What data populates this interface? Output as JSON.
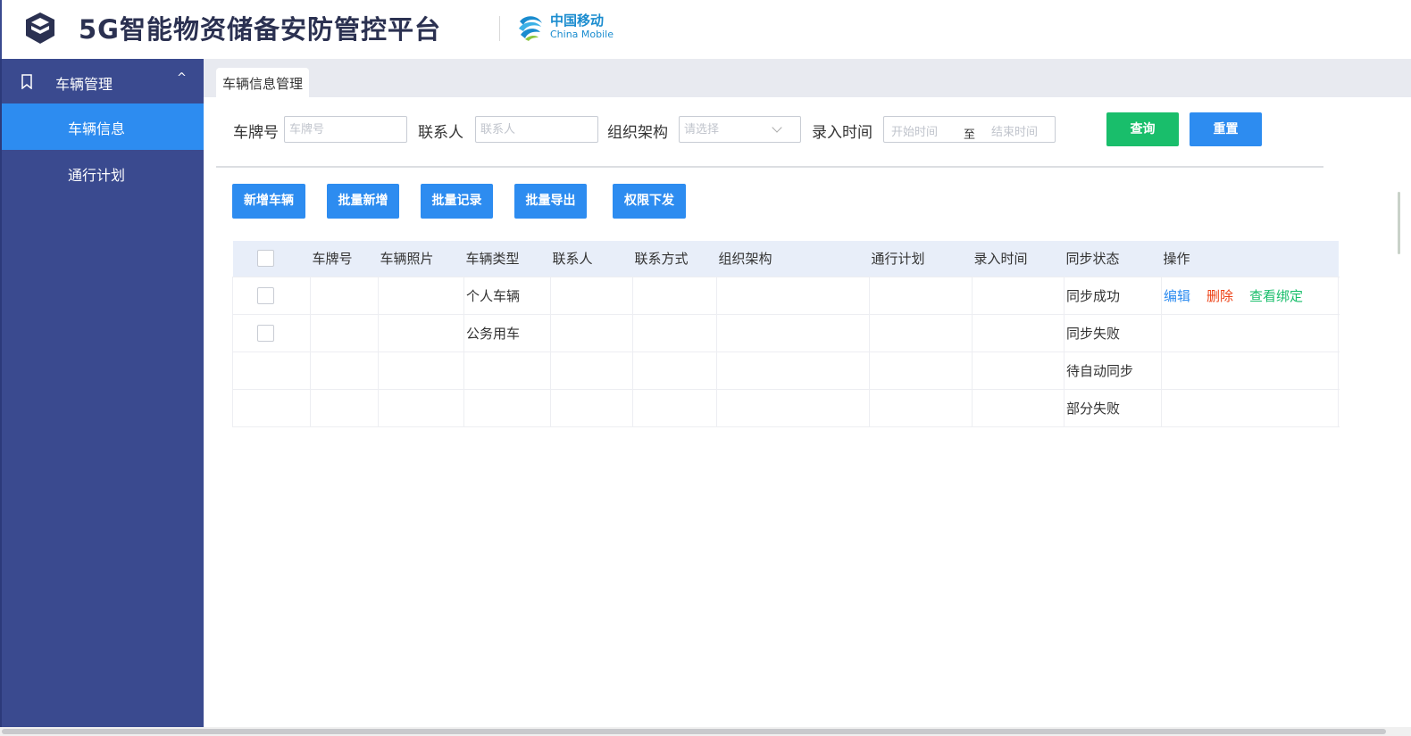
{
  "header": {
    "title": "5G智能物资储备安防管控平台",
    "partner_name": "中国移动",
    "partner_en": "China Mobile"
  },
  "sidebar": {
    "group": {
      "label": "车辆管理",
      "icon": "bookmark-icon",
      "expanded": true
    },
    "items": [
      {
        "label": "车辆信息",
        "active": true
      },
      {
        "label": "通行计划",
        "active": false
      }
    ]
  },
  "tabs": [
    {
      "label": "车辆信息管理"
    }
  ],
  "filters": {
    "plate": {
      "label": "车牌号",
      "placeholder": "车牌号"
    },
    "contact": {
      "label": "联系人",
      "placeholder": "联系人"
    },
    "org": {
      "label": "组织架构",
      "placeholder": "请选择"
    },
    "time": {
      "label": "录入时间",
      "start_placeholder": "开始时间",
      "separator": "至",
      "end_placeholder": "结束时间"
    },
    "query_label": "查询",
    "reset_label": "重置"
  },
  "actions": {
    "add": "新增车辆",
    "batch_add": "批量新增",
    "batch_record": "批量记录",
    "batch_export": "批量导出",
    "permission": "权限下发"
  },
  "table": {
    "columns": [
      "车牌号",
      "车辆照片",
      "车辆类型",
      "联系人",
      "联系方式",
      "组织架构",
      "通行计划",
      "录入时间",
      "同步状态",
      "操作"
    ],
    "rows": [
      {
        "type": "个人车辆",
        "status": "同步成功",
        "has_checkbox": true,
        "ops": {
          "edit": "编辑",
          "delete": "删除",
          "view": "查看绑定"
        }
      },
      {
        "type": "公务用车",
        "status": "同步失败",
        "has_checkbox": true
      },
      {
        "type": "",
        "status": "待自动同步",
        "has_checkbox": false
      },
      {
        "type": "",
        "status": "部分失败",
        "has_checkbox": false
      }
    ]
  },
  "colors": {
    "sidebar": "#3a4a8f",
    "accent": "#2d8cf0",
    "success": "#19be6b",
    "danger": "#ed4014"
  }
}
